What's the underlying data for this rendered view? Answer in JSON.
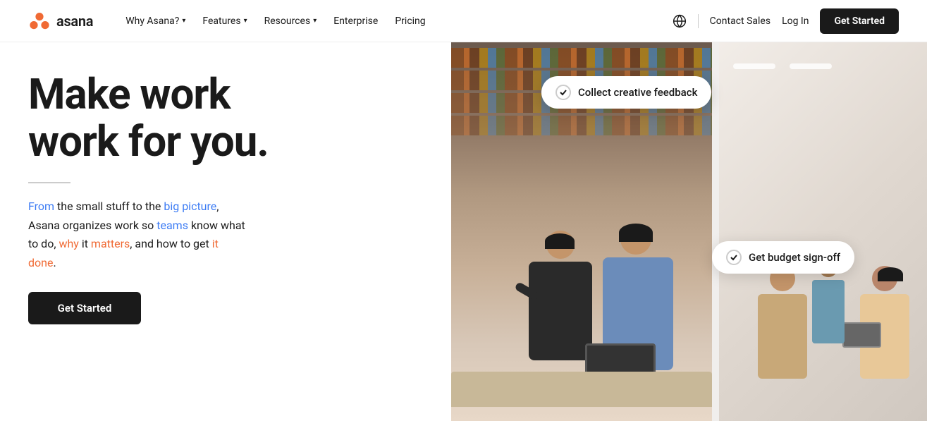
{
  "brand": {
    "name": "asana",
    "logo_alt": "Asana logo"
  },
  "nav": {
    "links": [
      {
        "id": "why-asana",
        "label": "Why Asana?",
        "has_dropdown": true
      },
      {
        "id": "features",
        "label": "Features",
        "has_dropdown": true
      },
      {
        "id": "resources",
        "label": "Resources",
        "has_dropdown": true
      },
      {
        "id": "enterprise",
        "label": "Enterprise",
        "has_dropdown": false
      },
      {
        "id": "pricing",
        "label": "Pricing",
        "has_dropdown": false
      }
    ],
    "right": {
      "contact_sales": "Contact Sales",
      "log_in": "Log In",
      "get_started": "Get Started"
    }
  },
  "hero": {
    "title_line1": "Make work",
    "title_line2": "work for you.",
    "description": "From the small stuff to the big picture, Asana organizes work so teams know what to do, why it matters, and how to get it done.",
    "cta_button": "Get Started"
  },
  "floating_cards": {
    "card1": {
      "label": "Collect creative feedback",
      "check": "✓"
    },
    "card2": {
      "label": "Get budget sign-off",
      "check": "✓"
    }
  },
  "colors": {
    "cta_bg": "#111111",
    "card_shadow": "rgba(0,0,0,0.15)",
    "text_blue": "#3d7cf4",
    "text_red": "#f06a34",
    "text_yellow": "#c8900a",
    "text_green": "#2e7d52"
  }
}
